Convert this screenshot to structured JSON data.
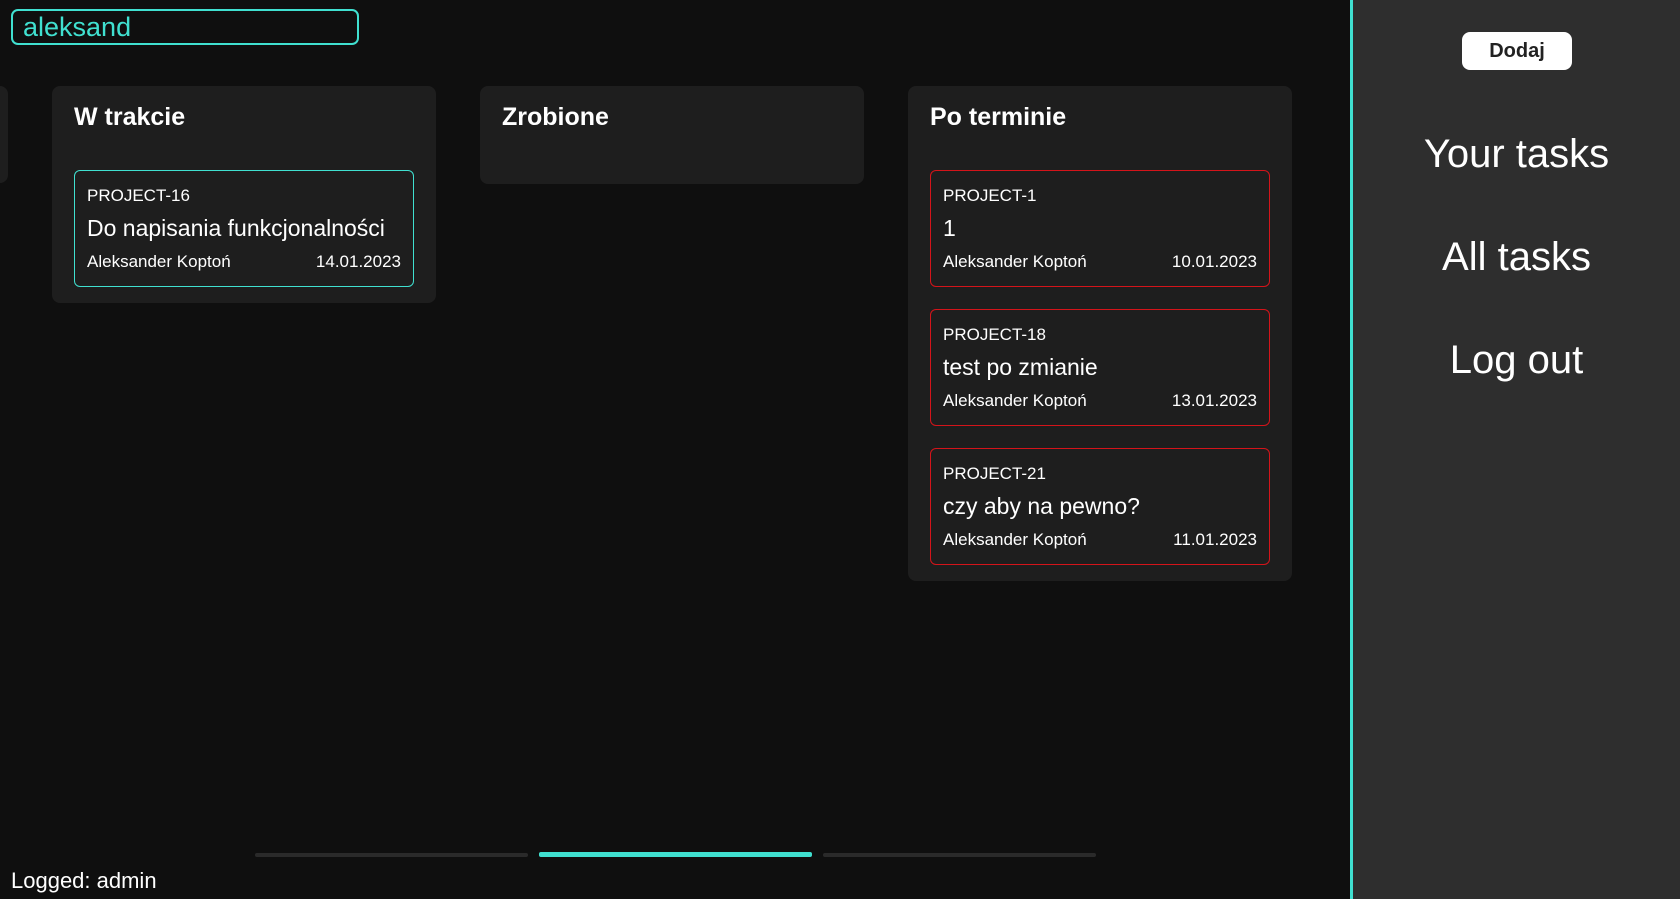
{
  "search": {
    "value": "aleksand"
  },
  "columns": [
    {
      "title": "W trakcie",
      "cards": [
        {
          "id": "PROJECT-16",
          "title": "Do napisania funkcjonalności",
          "assignee": "Aleksander Koptoń",
          "date": "14.01.2023",
          "status": "active"
        }
      ]
    },
    {
      "title": "Zrobione",
      "cards": []
    },
    {
      "title": "Po terminie",
      "cards": [
        {
          "id": "PROJECT-1",
          "title": "1",
          "assignee": "Aleksander Koptoń",
          "date": "10.01.2023",
          "status": "overdue"
        },
        {
          "id": "PROJECT-18",
          "title": "test po zmianie",
          "assignee": "Aleksander Koptoń",
          "date": "13.01.2023",
          "status": "overdue"
        },
        {
          "id": "PROJECT-21",
          "title": "czy aby na pewno?",
          "assignee": "Aleksander Koptoń",
          "date": "11.01.2023",
          "status": "overdue"
        }
      ]
    }
  ],
  "pager": {
    "pages": 3,
    "current_index": 1
  },
  "footer": {
    "logged_label": "Logged: admin"
  },
  "sidebar": {
    "add_label": "Dodaj",
    "nav": [
      "Your tasks",
      "All tasks",
      "Log out"
    ]
  },
  "colors": {
    "accent": "#40e0d0",
    "overdue": "#d4141a",
    "background": "#0f0f0f",
    "panel": "#1e1e1e",
    "sidebar": "#2e2e2e"
  }
}
